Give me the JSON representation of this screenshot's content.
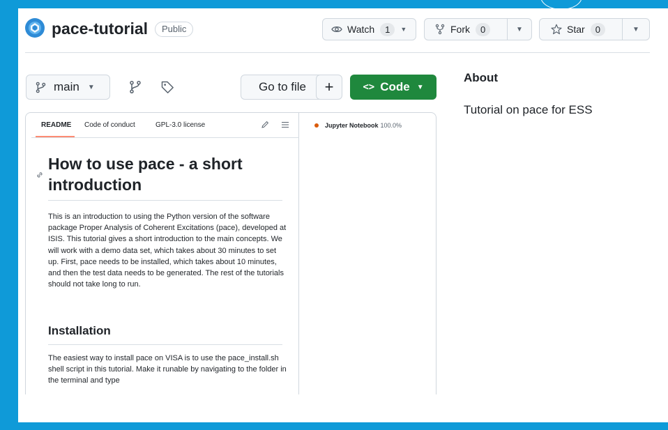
{
  "repo": {
    "name": "pace-tutorial",
    "visibility": "Public"
  },
  "actions": {
    "watch_label": "Watch",
    "watch_count": "1",
    "fork_label": "Fork",
    "fork_count": "0",
    "star_label": "Star",
    "star_count": "0"
  },
  "toolbar": {
    "branch": "main",
    "goto_file": "Go to file",
    "add": "+",
    "code_label": "Code"
  },
  "about": {
    "title": "About",
    "description": "Tutorial on pace for ESS"
  },
  "readme": {
    "tabs": [
      "README",
      "Code of conduct",
      "GPL-3.0 license"
    ],
    "heading": "How to use pace - a short introduction",
    "intro": "This is an introduction to using the Python version of the software package Proper Analysis of Coherent Excitations (pace), developed at ISIS. This tutorial gives a short introduction to the main concepts. We will work with a demo data set, which takes about 30 minutes to set up. First, pace needs to be installed, which takes about 10 minutes, and then the test data needs to be generated. The rest of the tutorials should not take long to run.",
    "section_heading": "Installation",
    "install_text": "The easiest way to install pace on VISA is to use the pace_install.sh shell script in this tutorial. Make it runable by navigating to the folder in the terminal and type"
  },
  "language": {
    "name": "Jupyter Notebook",
    "percent": "100.0%",
    "color": "#da5b0b"
  },
  "colors": {
    "frame_border": "#0f9ad8",
    "code_button": "#1f883d",
    "tab_underline": "#fd8c73"
  }
}
